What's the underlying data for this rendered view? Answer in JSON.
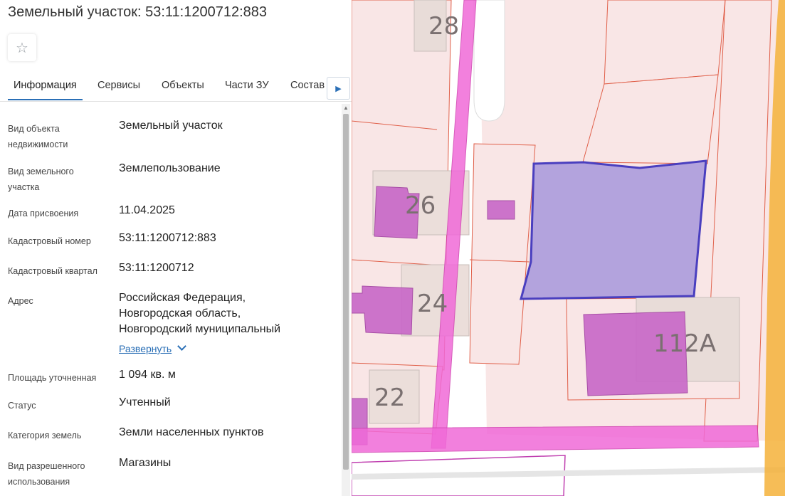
{
  "title": "Земельный участок: 53:11:1200712:883",
  "tabs": [
    "Информация",
    "Сервисы",
    "Объекты",
    "Части ЗУ",
    "Состав"
  ],
  "active_tab": "Информация",
  "fields": [
    {
      "label": "Вид объекта недвижимости",
      "value": "Земельный участок"
    },
    {
      "label": "Вид земельного участка",
      "value": "Землепользование"
    },
    {
      "label": "Дата присвоения",
      "value": "11.04.2025"
    },
    {
      "label": "Кадастровый номер",
      "value": "53:11:1200712:883"
    },
    {
      "label": "Кадастровый квартал",
      "value": "53:11:1200712"
    },
    {
      "label": "Адрес",
      "value": "Российская Федерация, Новгородская область, Новгородский муниципальный"
    },
    {
      "label": "Площадь уточненная",
      "value": "1 094 кв. м"
    },
    {
      "label": "Статус",
      "value": "Учтенный"
    },
    {
      "label": "Категория земель",
      "value": "Земли населенных пунктов"
    },
    {
      "label": "Вид разрешенного использования",
      "value": "Магазины"
    }
  ],
  "expand_link": "Развернуть",
  "icons": {
    "favorite": "star-icon",
    "tabs_next": "caret-right-icon",
    "expand": "chevron-down-icon"
  },
  "map": {
    "house_numbers": [
      "28",
      "26",
      "24",
      "22",
      "112А"
    ],
    "colors": {
      "parcel_fill": "#f9e6e6",
      "parcel_border": "#e0604a",
      "building_fill": "#c867c8",
      "road_fill": "#f06ad8",
      "selected_fill": "#b3a3dd",
      "selected_border": "#4a3fbf",
      "boundary_orange": "#f4b23a"
    }
  },
  "accent_color": "#2a6fb6"
}
